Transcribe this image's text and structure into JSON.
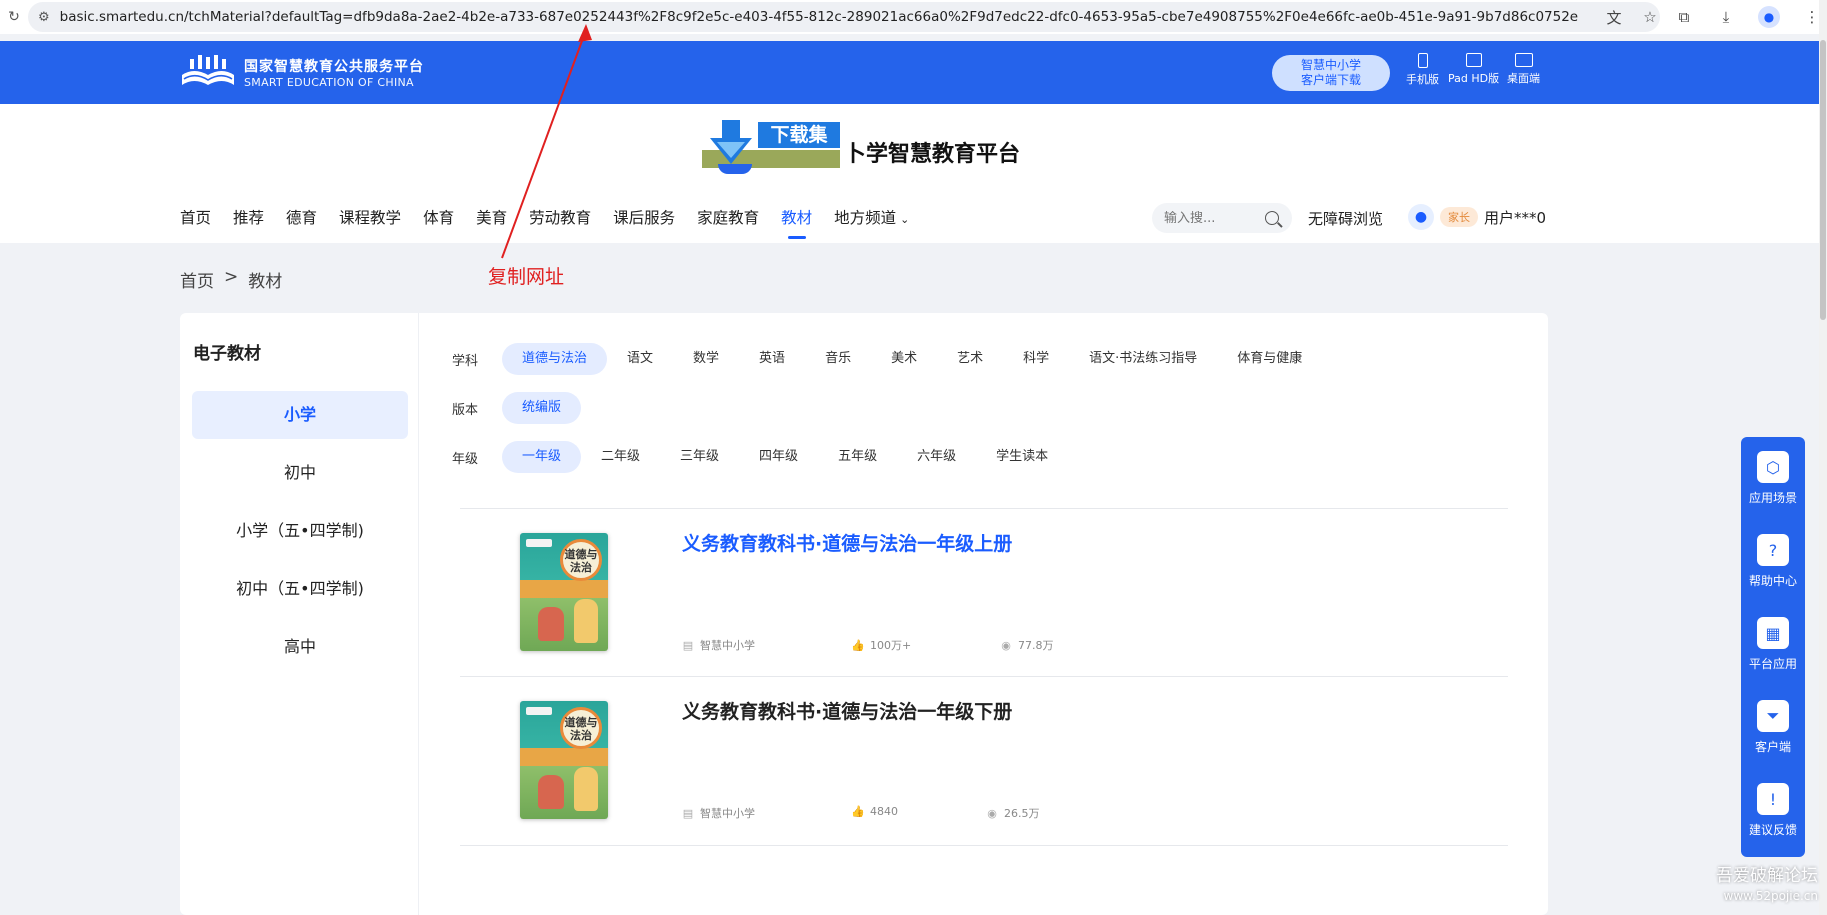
{
  "browser": {
    "url": "basic.smartedu.cn/tchMaterial?defaultTag=dfb9da8a-2ae2-4b2e-a733-687e0252443f%2F8c9f2e5c-e403-4f55-812c-289021ac66a0%2F9d7edc22-dfc0-4653-95a5-cbe7e4908755%2F0e4e66fc-ae0b-451e-9a91-9b7d86c0752e"
  },
  "topbar": {
    "logo_cn": "国家智慧教育公共服务平台",
    "logo_en": "SMART EDUCATION OF CHINA",
    "client_line1": "智慧中小学",
    "client_line2": "客户端下载",
    "devices": [
      "手机版",
      "Pad HD版",
      "桌面端"
    ]
  },
  "header": {
    "dl_badge": "下载集",
    "brand_title": "卜学智慧教育平台",
    "nav": [
      "首页",
      "推荐",
      "德育",
      "课程教学",
      "体育",
      "美育",
      "劳动教育",
      "课后服务",
      "家庭教育",
      "教材",
      "地方频道"
    ],
    "search_placeholder": "输入搜...",
    "a11y": "无障碍浏览",
    "user_role": "家长",
    "user_name": "用户***0"
  },
  "breadcrumb": [
    "首页",
    ">",
    "教材"
  ],
  "annotation": "复制网址",
  "sidebar": {
    "title": "电子教材",
    "items": [
      "小学",
      "初中",
      "小学（五•四学制)",
      "初中（五•四学制)",
      "高中"
    ]
  },
  "filters": {
    "subject_label": "学科",
    "subjects": [
      "道德与法治",
      "语文",
      "数学",
      "英语",
      "音乐",
      "美术",
      "艺术",
      "科学",
      "语文·书法练习指导",
      "体育与健康"
    ],
    "edition_label": "版本",
    "editions": [
      "统编版"
    ],
    "grade_label": "年级",
    "grades": [
      "一年级",
      "二年级",
      "三年级",
      "四年级",
      "五年级",
      "六年级",
      "学生读本"
    ]
  },
  "books": [
    {
      "title": "义务教育教科书·道德与法治一年级上册",
      "publisher": "智慧中小学",
      "likes": "100万+",
      "views": "77.8万",
      "cover_text": "道德与法治"
    },
    {
      "title": "义务教育教科书·道德与法治一年级下册",
      "publisher": "智慧中小学",
      "likes": "4840",
      "views": "26.5万",
      "cover_text": "道德与法治"
    }
  ],
  "float_panel": [
    "应用场景",
    "帮助中心",
    "平台应用",
    "客户端",
    "建议反馈"
  ],
  "watermark": {
    "line1": "吾爱破解论坛",
    "line2": "www.52pojie.cn"
  }
}
